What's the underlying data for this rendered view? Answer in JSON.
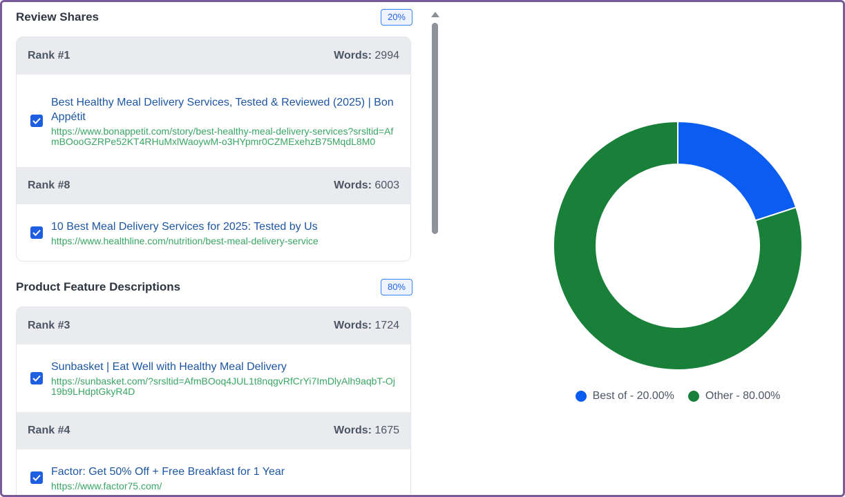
{
  "sections": [
    {
      "title": "Review Shares",
      "percent": "20%",
      "items": [
        {
          "rank": "Rank #1",
          "words_label": "Words:",
          "words": "2994",
          "checked": true,
          "title": "Best Healthy Meal Delivery Services, Tested & Reviewed (2025) | Bon Appétit",
          "url": "https://www.bonappetit.com/story/best-healthy-meal-delivery-services?srsltid=AfmBOooGZRPe52KT4RHuMxlWaoywM-o3HYpmr0CZMExehzB75MqdL8M0"
        },
        {
          "rank": "Rank #8",
          "words_label": "Words:",
          "words": "6003",
          "checked": true,
          "title": "10 Best Meal Delivery Services for 2025: Tested by Us",
          "url": "https://www.healthline.com/nutrition/best-meal-delivery-service"
        }
      ]
    },
    {
      "title": "Product Feature Descriptions",
      "percent": "80%",
      "items": [
        {
          "rank": "Rank #3",
          "words_label": "Words:",
          "words": "1724",
          "checked": true,
          "title": "Sunbasket | Eat Well with Healthy Meal Delivery",
          "url": "https://sunbasket.com/?srsltid=AfmBOoq4JUL1t8nqgvRfCrYi7ImDlyAlh9aqbT-Oj19b9LHdptGkyR4D"
        },
        {
          "rank": "Rank #4",
          "words_label": "Words:",
          "words": "1675",
          "checked": true,
          "title": "Factor: Get 50% Off + Free Breakfast for 1 Year",
          "url": "https://www.factor75.com/"
        }
      ]
    }
  ],
  "chart_data": {
    "type": "pie",
    "variant": "donut",
    "categories": [
      "Best of",
      "Other"
    ],
    "values": [
      20,
      80
    ],
    "colors": [
      "#0b5cf0",
      "#188038"
    ],
    "legend_labels": [
      "Best of - 20.00%",
      "Other - 80.00%"
    ],
    "legend_position": "bottom"
  }
}
